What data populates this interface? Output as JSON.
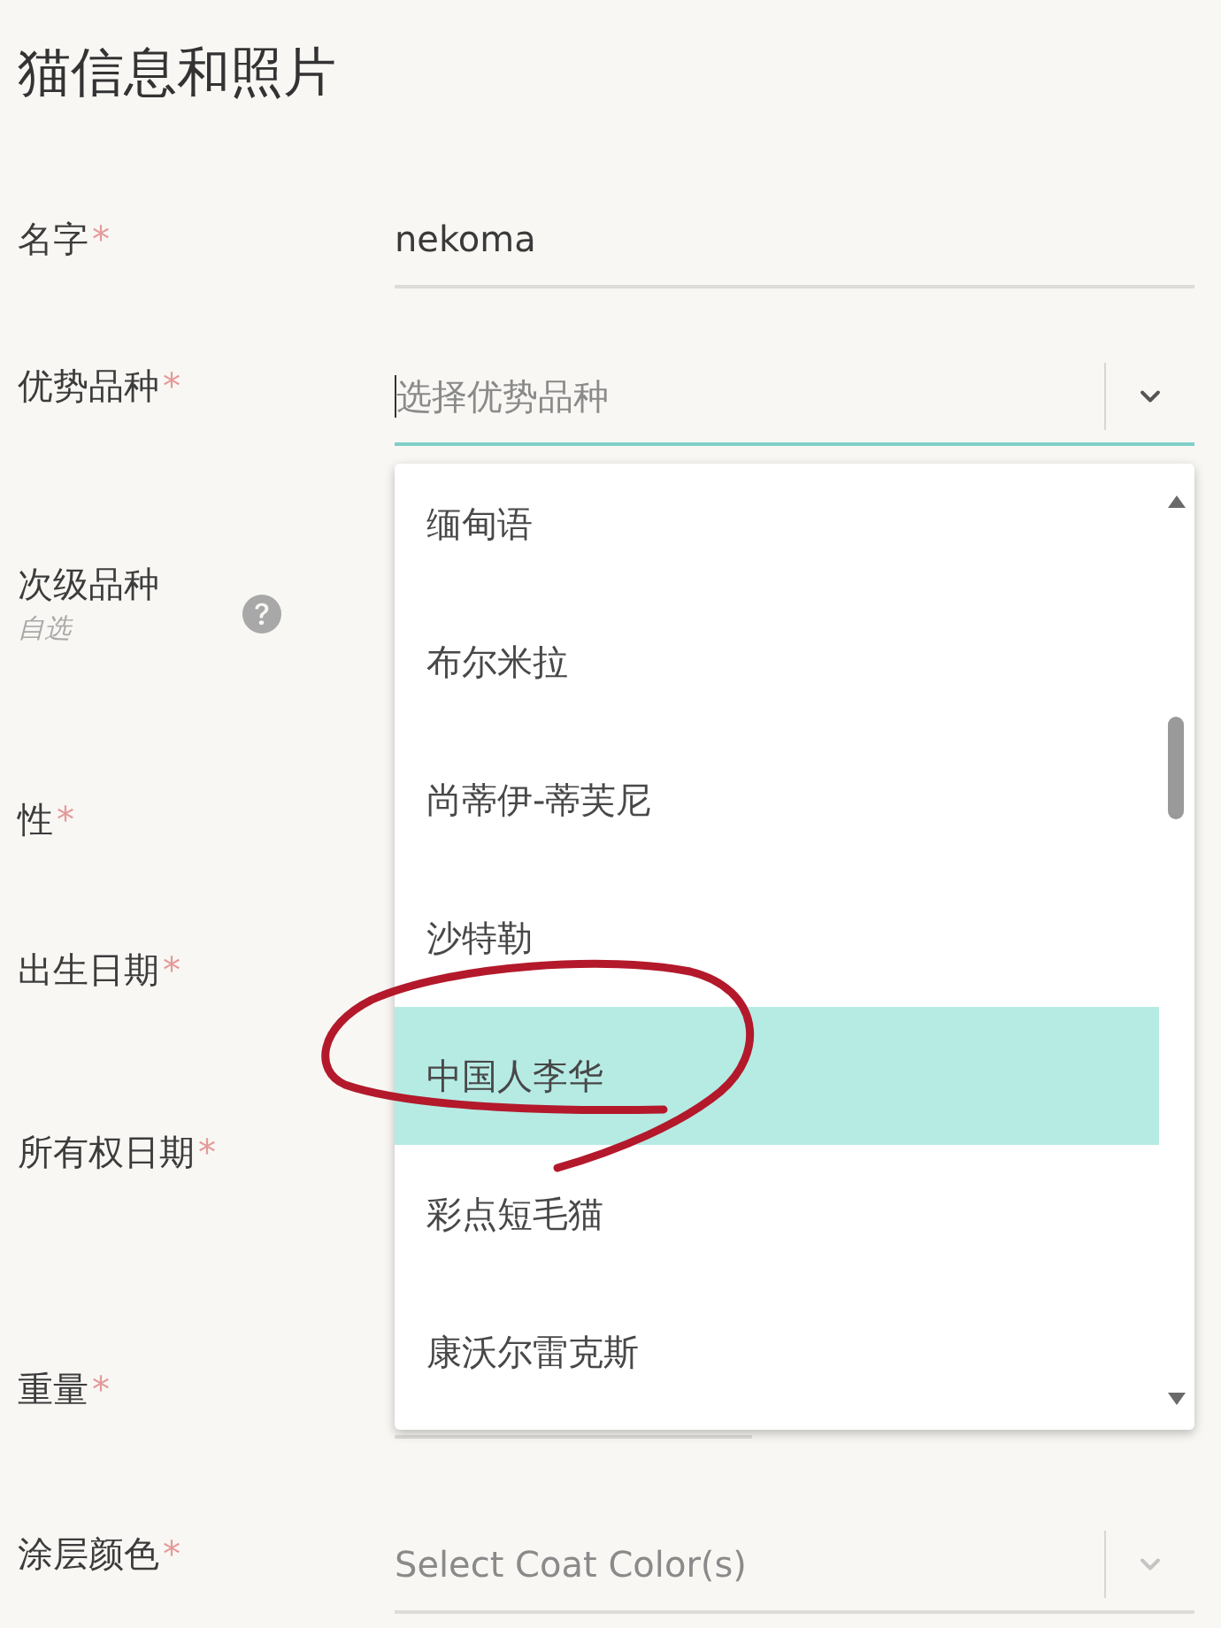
{
  "title": "猫信息和照片",
  "fields": [
    {
      "label": "名字",
      "required_mark": "*",
      "input": {
        "kind": "text",
        "value": "nekoma"
      }
    },
    {
      "label": "优势品种",
      "required_mark": "*",
      "input": {
        "kind": "select",
        "placeholder": "选择优势品种",
        "focused": true,
        "expanded": true,
        "options": [
          {
            "label": "缅甸语",
            "selected": false
          },
          {
            "label": "布尔米拉",
            "selected": false
          },
          {
            "label": "尚蒂伊-蒂芙尼",
            "selected": false
          },
          {
            "label": "沙特勒",
            "selected": false
          },
          {
            "label": "中国人李华",
            "selected": true
          },
          {
            "label": "彩点短毛猫",
            "selected": false
          },
          {
            "label": "康沃尔雷克斯",
            "selected": false
          }
        ]
      }
    },
    {
      "label": "次级品种",
      "hint": "自选",
      "help": true
    },
    {
      "label": "性",
      "required_mark": "*"
    },
    {
      "label": "出生日期",
      "required_mark": "*"
    },
    {
      "label": "所有权日期",
      "required_mark": "*"
    },
    {
      "label": "重量",
      "required_mark": "*",
      "input": {
        "kind": "text"
      }
    },
    {
      "label": "涂层颜色",
      "required_mark": "*",
      "input": {
        "kind": "select",
        "placeholder": "Select Coat Color(s)",
        "focused": false
      }
    }
  ]
}
